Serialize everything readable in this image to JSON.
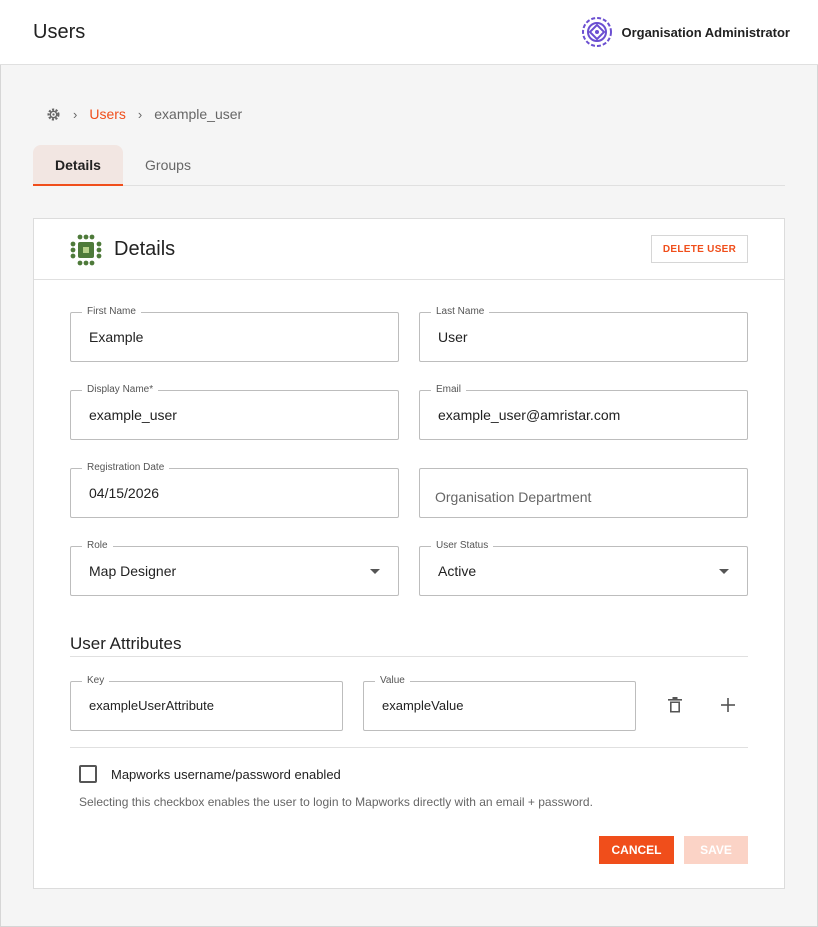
{
  "header": {
    "title": "Users",
    "org_name": "Organisation Administrator",
    "org_logo_icon": "org-emblem-icon"
  },
  "breadcrumb": {
    "root_icon": "gear-icon",
    "link": "Users",
    "current": "example_user"
  },
  "tabs": [
    {
      "label": "Details",
      "active": true
    },
    {
      "label": "Groups",
      "active": false
    }
  ],
  "card": {
    "title": "Details",
    "logo_icon": "grid-emblem-icon",
    "delete_label": "DELETE USER"
  },
  "fields": {
    "first_name": {
      "label": "First Name",
      "value": "Example"
    },
    "last_name": {
      "label": "Last Name",
      "value": "User"
    },
    "display_name": {
      "label": "Display Name*",
      "value": "example_user"
    },
    "email": {
      "label": "Email",
      "value": "example_user@amristar.com"
    },
    "registration_date": {
      "label": "Registration Date",
      "value": "04/15/2026"
    },
    "department": {
      "placeholder": "Organisation Department"
    },
    "role": {
      "label": "Role",
      "value": "Map Designer"
    },
    "status": {
      "label": "User Status",
      "value": "Active"
    }
  },
  "attributes": {
    "title": "User Attributes",
    "rows": [
      {
        "key_label": "Key",
        "key": "exampleUserAttribute",
        "value_label": "Value",
        "value": "exampleValue"
      }
    ],
    "delete_icon": "trash-icon",
    "add_icon": "plus-icon"
  },
  "mapworks": {
    "checkbox_label": "Mapworks username/password enabled",
    "checked": false,
    "hint": "Selecting this checkbox enables the user to login to Mapworks directly with an email + password."
  },
  "actions": {
    "cancel": "CANCEL",
    "save": "SAVE"
  },
  "colors": {
    "accent": "#f04e1b",
    "accent_disabled": "#fbd3c6",
    "org_logo": "#6b4fd1",
    "card_logo": "#4e7a3a"
  }
}
